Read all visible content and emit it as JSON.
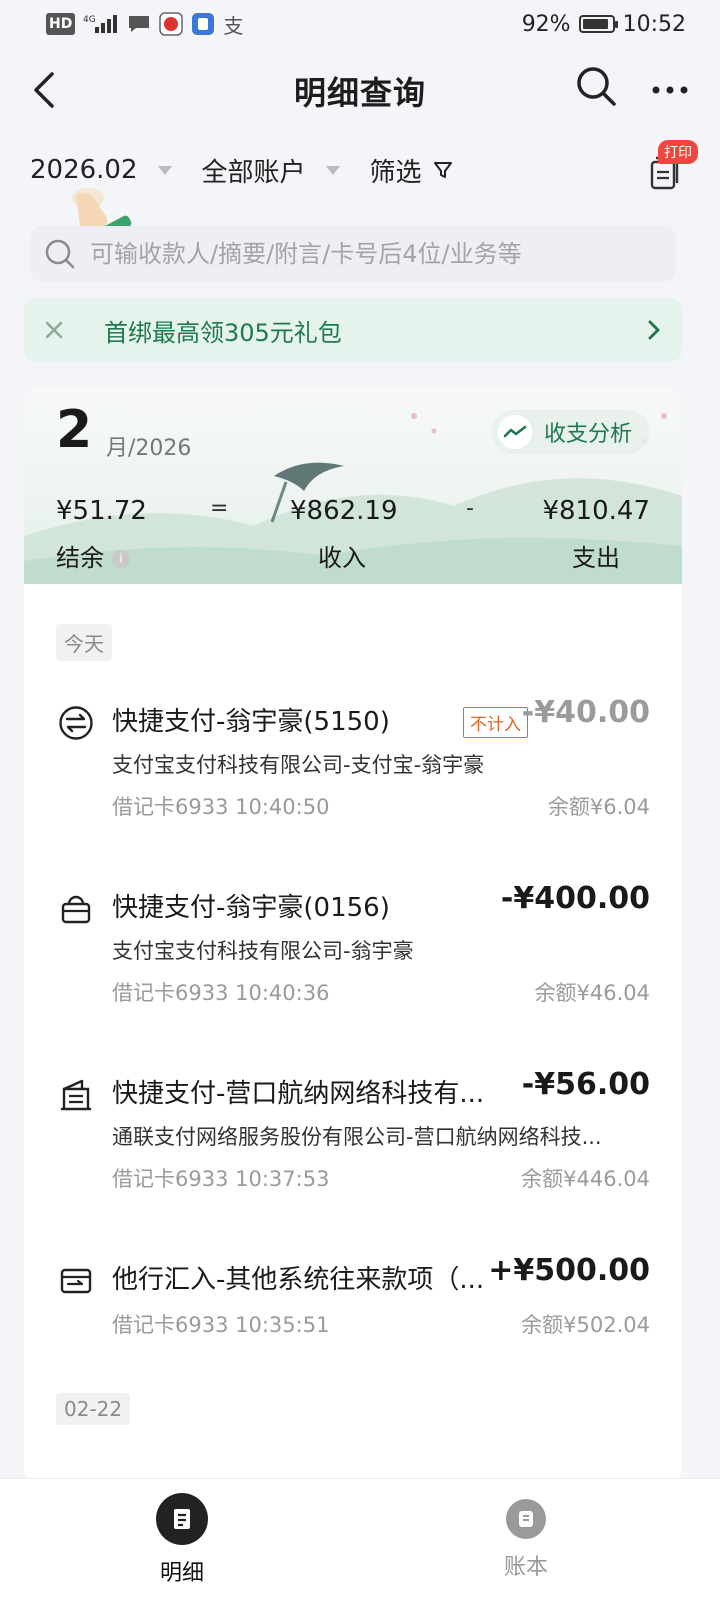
{
  "statusbar": {
    "hd": "HD",
    "network": "4G",
    "battery_pct": "92%",
    "battery_level": 0.92,
    "time": "10:52",
    "alipay_glyph": "支"
  },
  "navbar": {
    "title": "明细查询"
  },
  "filters": {
    "month": "2026.02",
    "account": "全部账户",
    "filter_label": "筛选",
    "print_badge": "打印"
  },
  "search": {
    "placeholder": "可输收款人/摘要/附言/卡号后4位/业务等"
  },
  "promo": {
    "text": "首绑最高领305元礼包"
  },
  "summary": {
    "month": "2",
    "year": "月/2026",
    "analysis_label": "收支分析",
    "balance_value": "¥51.72",
    "balance_label": "结余",
    "equals": "=",
    "income_value": "¥862.19",
    "income_label": "收入",
    "minus": "-",
    "expense_value": "¥810.47",
    "expense_label": "支出"
  },
  "list": {
    "today_tag": "今天",
    "next_day_tag": "02-22",
    "transactions": [
      {
        "icon": "transfer-icon",
        "title": "快捷支付-翁宇豪(5150)",
        "subtitle": "支付宝支付科技有限公司-支付宝-翁宇豪",
        "meta": "借记卡6933 10:40:50",
        "amount": "-¥40.00",
        "balance": "余额¥6.04",
        "badge": "不计入"
      },
      {
        "icon": "shopping-basket-icon",
        "title": "快捷支付-翁宇豪(0156)",
        "subtitle": "支付宝支付科技有限公司-翁宇豪",
        "meta": "借记卡6933 10:40:36",
        "amount": "-¥400.00",
        "balance": "余额¥46.04"
      },
      {
        "icon": "building-icon",
        "title": "快捷支付-营口航纳网络科技有...",
        "subtitle": "通联支付网络服务股份有限公司-营口航纳网络科技...",
        "meta": "借记卡6933 10:37:53",
        "amount": "-¥56.00",
        "balance": "余额¥446.04"
      },
      {
        "icon": "transfer-in-icon",
        "title": "他行汇入-其他系统往来款项（...",
        "meta": "借记卡6933 10:35:51",
        "amount": "+¥500.00",
        "balance": "余额¥502.04"
      }
    ]
  },
  "tabbar": {
    "tabs": [
      {
        "label": "明细",
        "active": true
      },
      {
        "label": "账本",
        "active": false
      }
    ]
  },
  "colors": {
    "brand_green": "#1f7a4d",
    "promo_bg": "#e6f2ec",
    "badge_red": "#f1463f",
    "badge_orange": "#e0662a"
  }
}
